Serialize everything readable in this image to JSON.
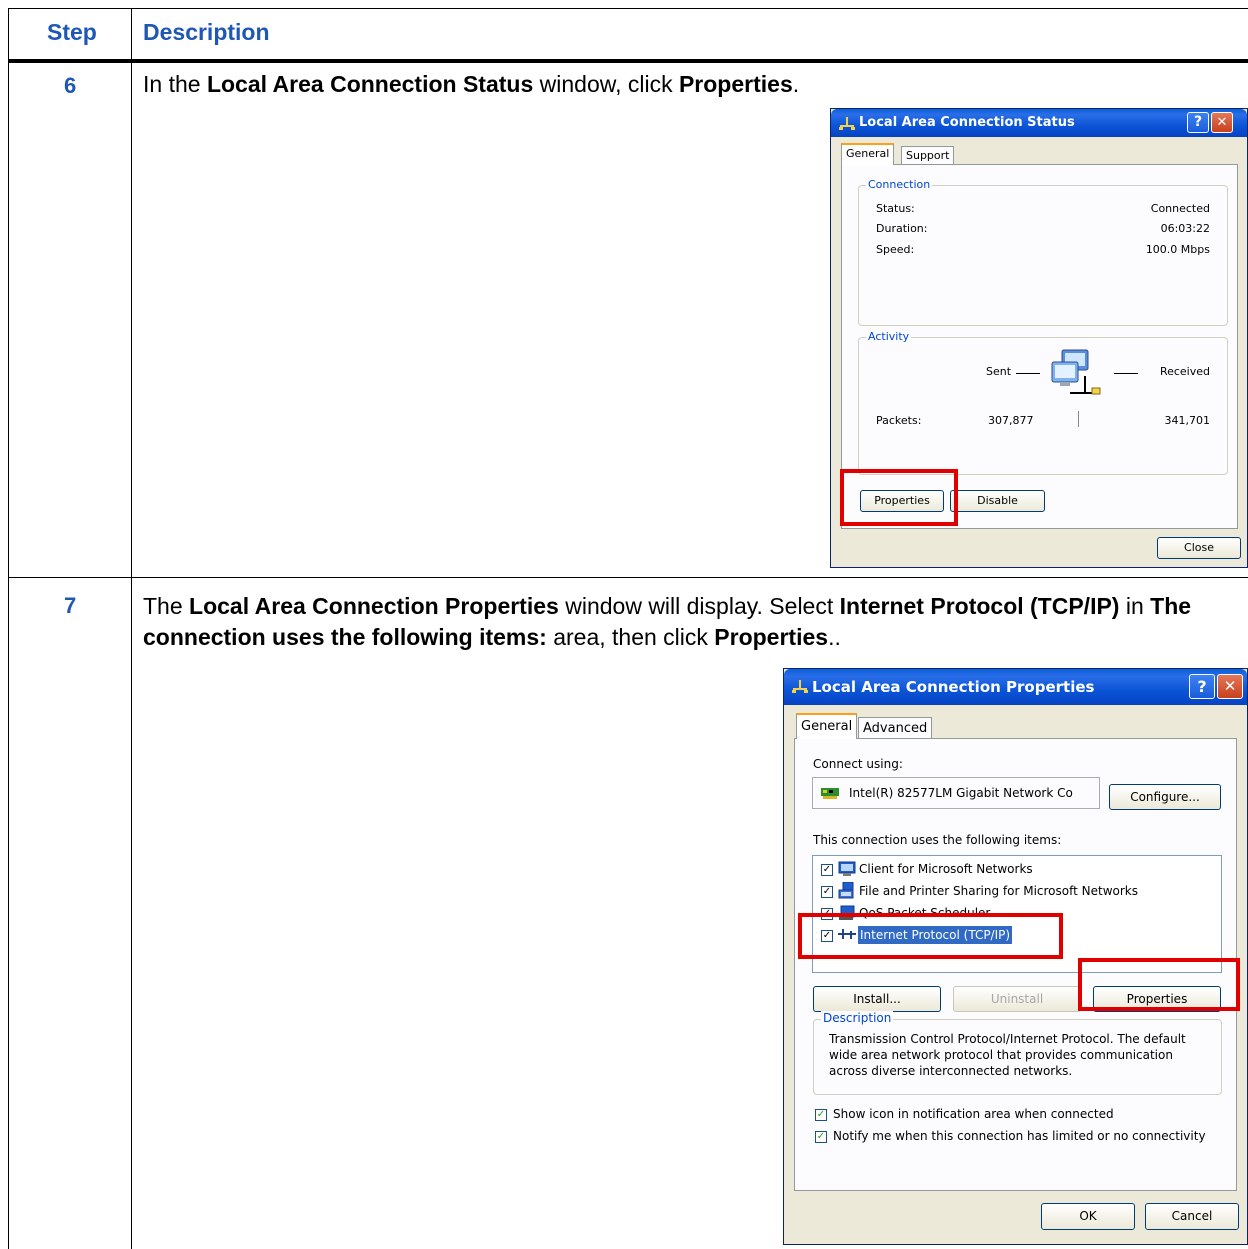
{
  "table": {
    "header_step": "Step",
    "header_description": "Description",
    "rows": [
      {
        "step": "6",
        "text": [
          {
            "t": "In the ",
            "b": false
          },
          {
            "t": "Local Area Connection Status",
            "b": true
          },
          {
            "t": " window, click ",
            "b": false
          },
          {
            "t": "Properties",
            "b": true
          },
          {
            "t": ".",
            "b": false
          }
        ]
      },
      {
        "step": "7",
        "text": [
          {
            "t": "The ",
            "b": false
          },
          {
            "t": "Local Area Connection Properties",
            "b": true
          },
          {
            "t": " window will display. Select ",
            "b": false
          },
          {
            "t": "Internet Protocol (TCP/IP)",
            "b": true
          },
          {
            "t": " in ",
            "b": false
          },
          {
            "t": "The connection uses the following items:",
            "b": true
          },
          {
            "t": " area, then click ",
            "b": false
          },
          {
            "t": "Properties",
            "b": true
          },
          {
            "t": "..",
            "b": false
          }
        ]
      }
    ]
  },
  "status_dialog": {
    "title": "Local Area Connection Status",
    "help_glyph": "?",
    "close_glyph": "✕",
    "tabs": [
      "General",
      "Support"
    ],
    "connection_group": "Connection",
    "status_label": "Status:",
    "status_value": "Connected",
    "duration_label": "Duration:",
    "duration_value": "06:03:22",
    "speed_label": "Speed:",
    "speed_value": "100.0 Mbps",
    "activity_group": "Activity",
    "sent_label": "Sent",
    "received_label": "Received",
    "packets_label": "Packets:",
    "packets_sent": "307,877",
    "packets_received": "341,701",
    "properties_button": "Properties",
    "disable_button": "Disable",
    "close_button": "Close",
    "icons": [
      "network-connection-icon",
      "network-computers-icon"
    ]
  },
  "props_dialog": {
    "title": "Local Area Connection Properties",
    "help_glyph": "?",
    "close_glyph": "✕",
    "tabs": [
      "General",
      "Advanced"
    ],
    "connect_using_label": "Connect using:",
    "adapter_name": "Intel(R) 82577LM Gigabit Network Co",
    "configure_button": "Configure...",
    "items_label": "This connection uses the following items:",
    "items": [
      {
        "label": "Client for Microsoft Networks",
        "checked": true
      },
      {
        "label": "File and Printer Sharing for Microsoft Networks",
        "checked": true
      },
      {
        "label": "QoS Packet Scheduler",
        "checked": true
      },
      {
        "label": "Internet Protocol (TCP/IP)",
        "checked": true,
        "selected": true
      }
    ],
    "install_button": "Install...",
    "uninstall_button": "Uninstall",
    "properties_button": "Properties",
    "description_group": "Description",
    "description_text": "Transmission Control Protocol/Internet Protocol. The default wide area network protocol that provides communication across diverse interconnected networks.",
    "show_icon_option": "Show icon in notification area when connected",
    "notify_option": "Notify me when this connection has limited or no connectivity",
    "ok_button": "OK",
    "cancel_button": "Cancel",
    "highlight_color": "#316ac5",
    "callout_color": "#e00000"
  }
}
